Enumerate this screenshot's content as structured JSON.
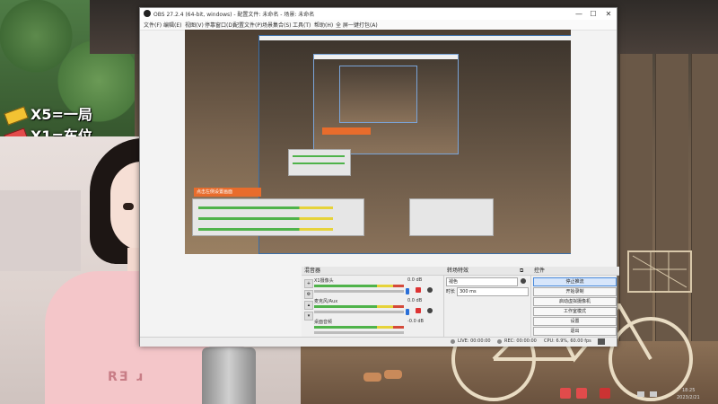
{
  "overlay": {
    "rule1": "X5=一局",
    "rule2": "X1=车位"
  },
  "webcam": {
    "shirt_text": "RƎ ɹ"
  },
  "obs": {
    "title": "OBS 27.2.4 (64-bit, windows) - 配置文件: 未命名 - 场景: 未命名",
    "menus": [
      "文件(F)",
      "编辑(E)",
      "视图(V)",
      "停靠窗口(D)",
      "配置文件(P)",
      "场景集合(S)",
      "工具(T)",
      "帮助(H)",
      "全 屏一键打包(A)"
    ],
    "orange_label": "点击左侧设置画面",
    "mixer": {
      "title": "混音器",
      "channels": [
        {
          "name": "X1摄像头",
          "db": "0.0 dB"
        },
        {
          "name": "麦克风/Aux",
          "db": "0.0 dB"
        },
        {
          "name": "桌面音频",
          "db": "-0.0 dB"
        }
      ]
    },
    "transitions": {
      "title": "转场特效",
      "type": "褪色",
      "duration_label": "时长",
      "duration_value": "300 ms"
    },
    "controls": {
      "title": "控件",
      "buttons": [
        "停止推流",
        "开始录制",
        "启动虚拟摄像机",
        "工作室模式",
        "设置",
        "退出"
      ]
    },
    "status": {
      "live": "LIVE: 00:00:00",
      "rec": "REC: 00:00:00",
      "cpu": "CPU: 6.9%, 60.00 fps"
    },
    "window_buttons": {
      "min": "—",
      "max": "☐",
      "close": "✕"
    }
  },
  "tray": {
    "time": "18:25",
    "date": "2023/2/21"
  },
  "colors": {
    "accent_blue": "#2a6fd8",
    "orange": "#e86c2c",
    "ticket_yellow": "#f2c232"
  }
}
